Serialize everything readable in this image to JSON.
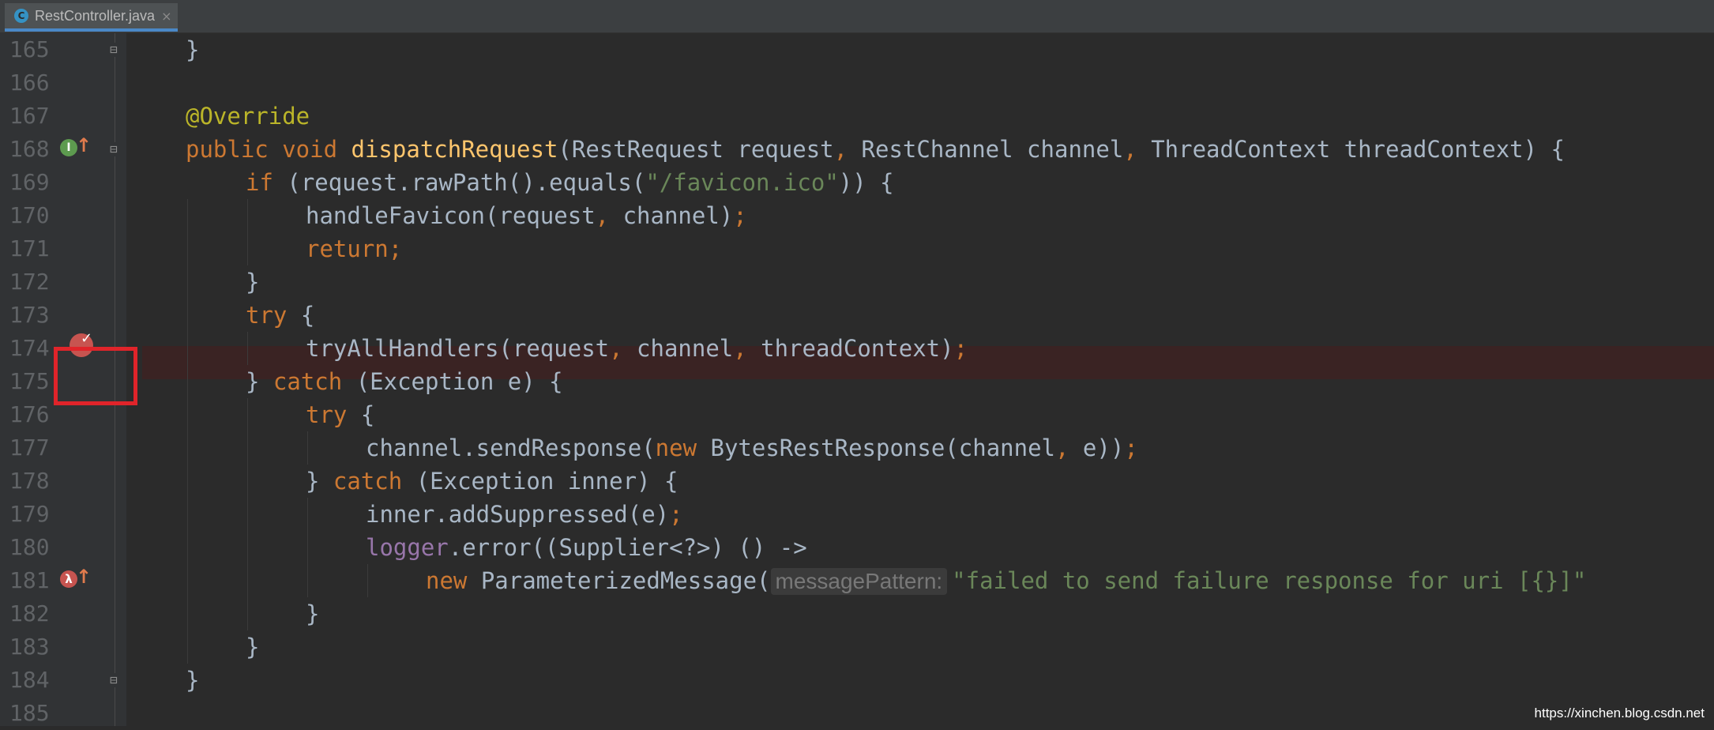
{
  "tab": {
    "label": "RestController.java",
    "icon_letter": "C",
    "close": "×"
  },
  "editor": {
    "line_numbers": [
      "165",
      "166",
      "167",
      "168",
      "169",
      "170",
      "171",
      "172",
      "173",
      "174",
      "175",
      "176",
      "177",
      "178",
      "179",
      "180",
      "181",
      "182",
      "183",
      "184",
      "185"
    ],
    "breakpoint_line": "174",
    "code": {
      "l165": "}",
      "l167": "@Override",
      "l168_kw": "public void ",
      "l168_fn": "dispatchRequest",
      "l168_a": "(RestRequest request",
      "l168_c1": ", ",
      "l168_b": "RestChannel channel",
      "l168_c2": ", ",
      "l168_d": "ThreadContext threadContext) {",
      "l169_kw": "if ",
      "l169_a": "(request.rawPath().equals(",
      "l169_str": "\"/favicon.ico\"",
      "l169_b": ")) {",
      "l170_a": "handleFavicon(request",
      "l170_c": ", ",
      "l170_b": "channel)",
      "l170_semi": ";",
      "l171": "return;",
      "l172": "}",
      "l173_kw": "try ",
      "l173_b": "{",
      "l174_a": "tryAllHandlers(request",
      "l174_c1": ", ",
      "l174_b": "channel",
      "l174_c2": ", ",
      "l174_d": "threadContext)",
      "l174_semi": ";",
      "l175_a": "} ",
      "l175_kw": "catch ",
      "l175_b": "(Exception e) {",
      "l176_kw": "try ",
      "l176_b": "{",
      "l177_a": "channel.sendResponse(",
      "l177_kw": "new ",
      "l177_b": "BytesRestResponse(channel",
      "l177_c": ", ",
      "l177_d": "e))",
      "l177_semi": ";",
      "l178_a": "} ",
      "l178_kw": "catch ",
      "l178_b": "(Exception inner) {",
      "l179_a": "inner.addSuppressed(e)",
      "l179_semi": ";",
      "l180_fld": "logger",
      "l180_a": ".error((Supplier<?>) () ->",
      "l181_kw": "new ",
      "l181_a": "ParameterizedMessage(",
      "l181_hint": "messagePattern:",
      "l181_str": "\"failed to send failure response for uri [{}]\"",
      "l182": "}",
      "l183": "}",
      "l184": "}"
    }
  },
  "icons": {
    "implements": "implements-icon",
    "overrides_arrow": "arrow-up-icon",
    "lambda": "lambda-icon",
    "breakpoint": "breakpoint-icon",
    "fold": "fold-marker-icon"
  },
  "colors": {
    "background": "#2b2b2b",
    "keyword": "#cc7832",
    "annotation": "#bbb529",
    "method": "#ffc66d",
    "string": "#6a8759",
    "field": "#9876aa",
    "breakpoint": "#c75450",
    "highlight_box": "#e0242a"
  },
  "watermark": "https://xinchen.blog.csdn.net"
}
